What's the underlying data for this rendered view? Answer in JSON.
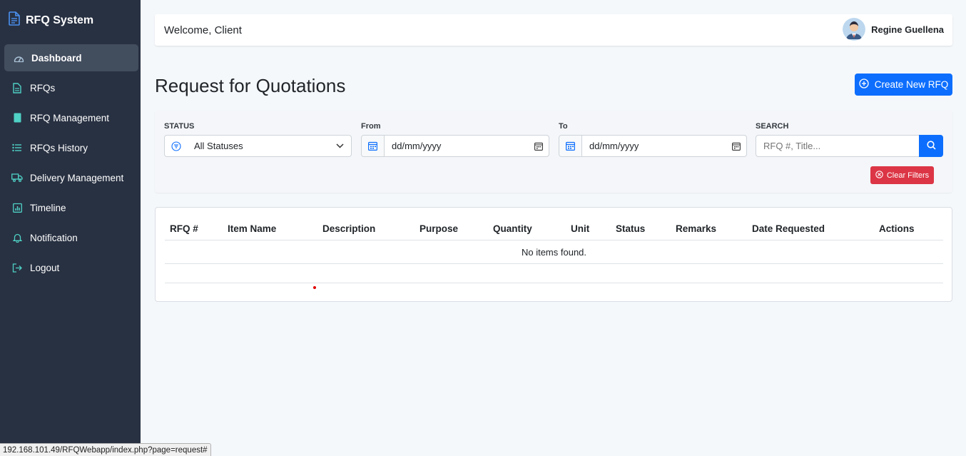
{
  "brand": {
    "title": "RFQ System",
    "icon": "document-icon"
  },
  "sidebar": {
    "items": [
      {
        "label": "Dashboard",
        "icon": "speedometer-icon",
        "active": true
      },
      {
        "label": "RFQs",
        "icon": "file-text-icon"
      },
      {
        "label": "RFQ Management",
        "icon": "bookmark-icon"
      },
      {
        "label": "RFQs History",
        "icon": "list-icon"
      },
      {
        "label": "Delivery Management",
        "icon": "truck-icon"
      },
      {
        "label": "Timeline",
        "icon": "calendar-chart-icon"
      },
      {
        "label": "Notification",
        "icon": "bell-icon"
      },
      {
        "label": "Logout",
        "icon": "logout-icon"
      }
    ]
  },
  "header": {
    "welcome": "Welcome, Client",
    "user_name": "Regine Guellena"
  },
  "page": {
    "title": "Request for Quotations",
    "create_label": "Create New RFQ"
  },
  "filters": {
    "status_label": "STATUS",
    "status_value": "All Statuses",
    "from_label": "From",
    "from_placeholder": "dd/mm/yyyy",
    "to_label": "To",
    "to_placeholder": "dd/mm/yyyy",
    "search_label": "SEARCH",
    "search_placeholder": "RFQ #, Title...",
    "clear_label": "Clear Filters"
  },
  "table": {
    "columns": [
      "RFQ #",
      "Item Name",
      "Description",
      "Purpose",
      "Quantity",
      "Unit",
      "Status",
      "Remarks",
      "Date Requested",
      "Actions"
    ],
    "empty_text": "No items found."
  },
  "status_bar": {
    "url": "192.168.101.49/RFQWebapp/index.php?page=request#"
  },
  "colors": {
    "sidebar": "#283142",
    "primary": "#0d6efd",
    "danger": "#dc3545",
    "accent_icon": "#4fd1c5"
  }
}
